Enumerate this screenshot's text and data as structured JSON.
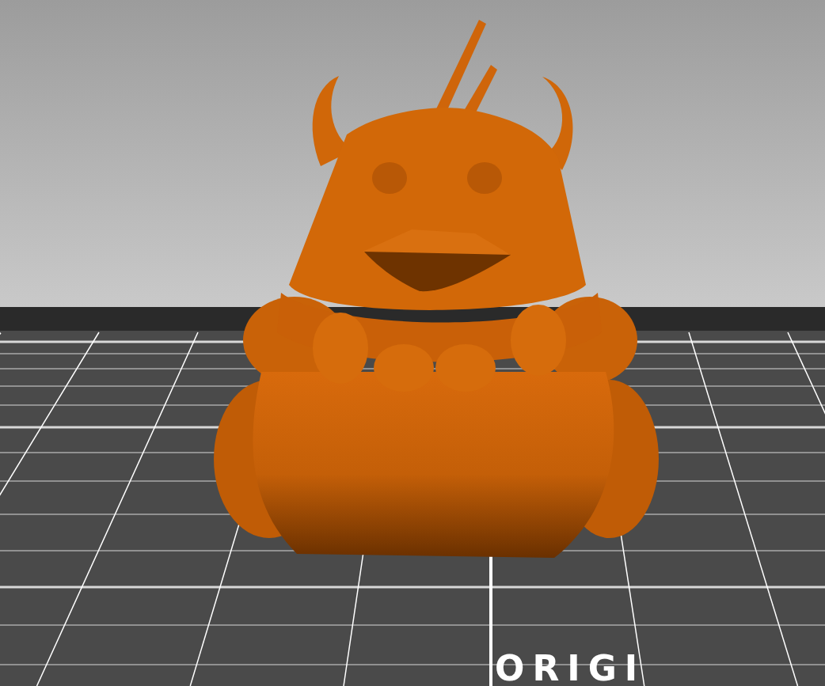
{
  "viewport": {
    "bed_label": "ORIGI"
  }
}
